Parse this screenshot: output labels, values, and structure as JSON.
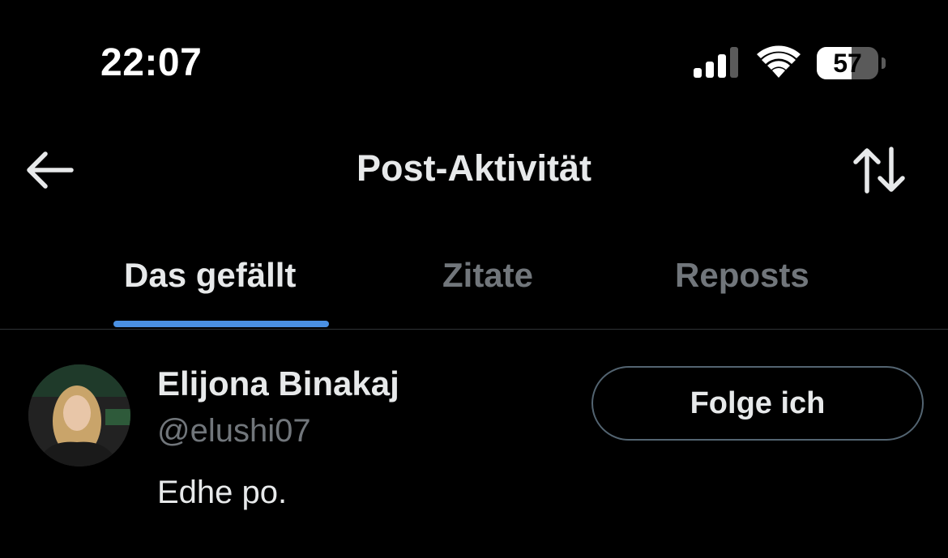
{
  "status_bar": {
    "time": "22:07",
    "battery_level": "57",
    "battery_fraction": 0.57,
    "icons": [
      "signal-icon",
      "wifi-icon",
      "battery-icon"
    ]
  },
  "header": {
    "title": "Post-Aktivität",
    "back_icon": "back-arrow-icon",
    "sort_icon": "sort-arrows-icon"
  },
  "tabs": [
    {
      "label": "Das gefällt",
      "active": true
    },
    {
      "label": "Zitate",
      "active": false
    },
    {
      "label": "Reposts",
      "active": false
    }
  ],
  "colors": {
    "background": "#000000",
    "primary_text": "#e7e9ea",
    "secondary_text": "#71767b",
    "accent": "#4a90e2",
    "divider": "#2f3336"
  },
  "users": [
    {
      "display_name": "Elijona Binakaj",
      "handle": "@elushi07",
      "bio": "Edhe po.",
      "follow_label": "Folge ich"
    }
  ]
}
